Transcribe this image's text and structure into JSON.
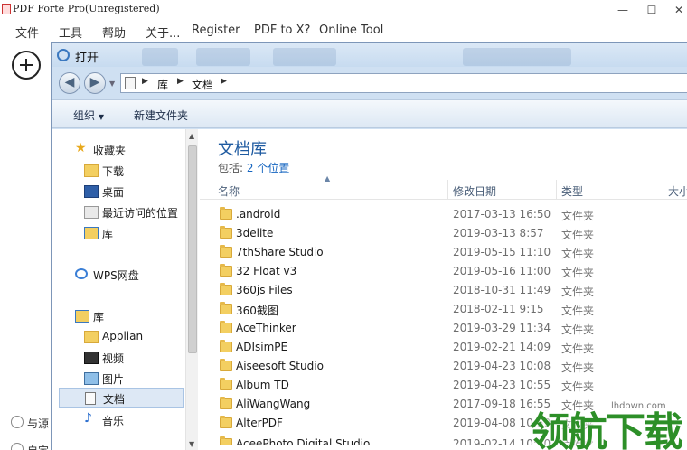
{
  "app": {
    "title": "PDF Forte Pro(Unregistered)",
    "menu": [
      "文件",
      "工具",
      "帮助",
      "关于...",
      "Register",
      "PDF to X?",
      "Online Tool"
    ],
    "radio_1": "与源",
    "radio_2": "自定"
  },
  "dialog": {
    "title": "打开",
    "breadcrumb": [
      "库",
      "文档"
    ],
    "commands": {
      "organize": "组织",
      "new_folder": "新建文件夹"
    },
    "nav": {
      "favorites": "收藏夹",
      "downloads": "下载",
      "desktop": "桌面",
      "recent": "最近访问的位置",
      "library_fav": "库",
      "wps": "WPS网盘",
      "libraries": "库",
      "applian": "Applian",
      "videos": "视频",
      "pictures": "图片",
      "documents": "文档",
      "music": "音乐"
    },
    "library": {
      "title": "文档库",
      "includes_prefix": "包括:",
      "includes_link": "2 个位置"
    },
    "columns": {
      "name": "名称",
      "date": "修改日期",
      "type": "类型",
      "size": "大小"
    },
    "files": [
      {
        "name": ".android",
        "date": "2017-03-13 16:50",
        "type": "文件夹"
      },
      {
        "name": "3delite",
        "date": "2019-03-13 8:57",
        "type": "文件夹"
      },
      {
        "name": "7thShare Studio",
        "date": "2019-05-15 11:10",
        "type": "文件夹"
      },
      {
        "name": "32 Float v3",
        "date": "2019-05-16 11:00",
        "type": "文件夹"
      },
      {
        "name": "360js Files",
        "date": "2018-10-31 11:49",
        "type": "文件夹"
      },
      {
        "name": "360截图",
        "date": "2018-02-11 9:15",
        "type": "文件夹"
      },
      {
        "name": "AceThinker",
        "date": "2019-03-29 11:34",
        "type": "文件夹"
      },
      {
        "name": "ADIsimPE",
        "date": "2019-02-21 14:09",
        "type": "文件夹"
      },
      {
        "name": "Aiseesoft Studio",
        "date": "2019-04-23 10:08",
        "type": "文件夹"
      },
      {
        "name": "Album TD",
        "date": "2019-04-23 10:55",
        "type": "文件夹"
      },
      {
        "name": "AliWangWang",
        "date": "2017-09-18 16:55",
        "type": "文件夹"
      },
      {
        "name": "AlterPDF",
        "date": "2019-04-08 10:59",
        "type": "文件夹"
      },
      {
        "name": "AceePhoto Digital Studio",
        "date": "2019-02-14 10:20",
        "type": "文件夹"
      }
    ]
  },
  "watermark": {
    "text": "领航下载",
    "url": "lhdown.com"
  },
  "colors": {
    "accent": "#1e5aa0",
    "folder": "#f3cf61",
    "watermark": "#2d8f28"
  }
}
